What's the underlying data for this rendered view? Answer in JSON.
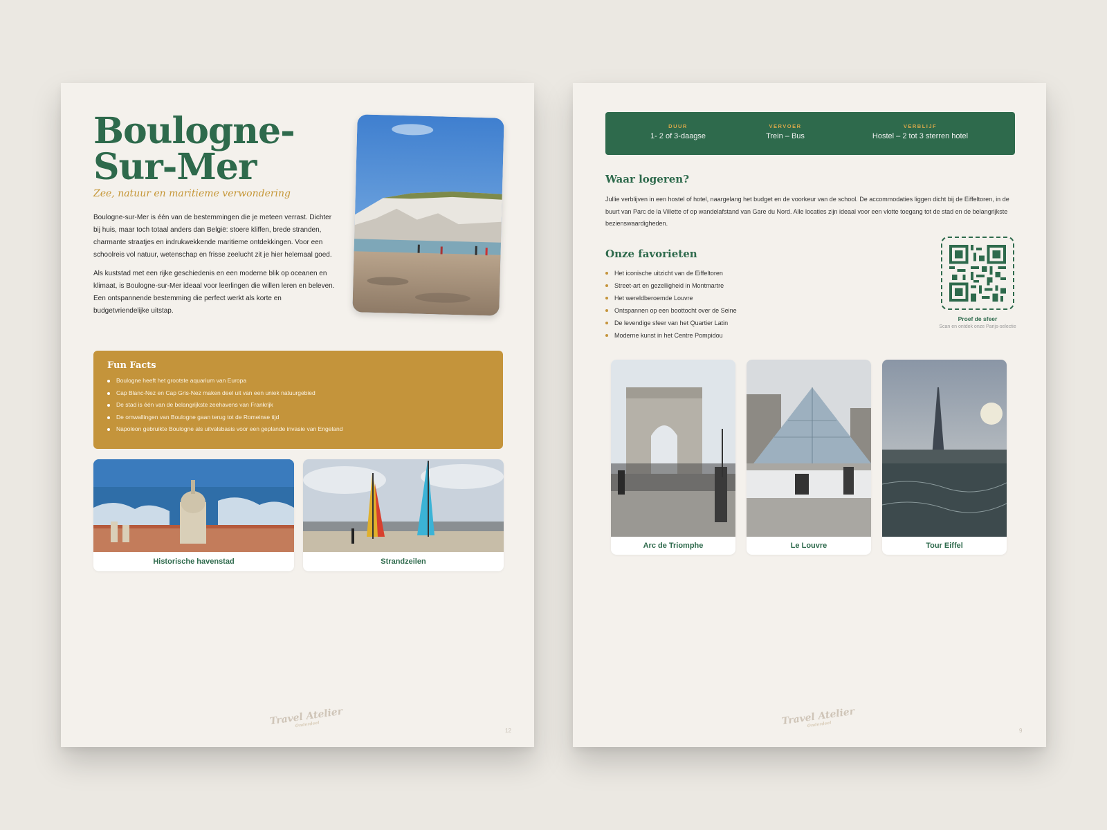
{
  "left_page": {
    "title_line1": "Boulogne-",
    "title_line2": "Sur-Mer",
    "subtitle": "Zee, natuur en maritieme verwondering",
    "paragraphs": [
      "Boulogne-sur-Mer is één van de bestemmingen die je meteen verrast. Dichter bij huis, maar toch totaal anders dan België: stoere kliffen, brede stranden, charmante straatjes en indrukwekkende maritieme ontdekkingen. Voor een schoolreis vol natuur, wetenschap en frisse zeelucht zit je hier helemaal goed.",
      "Als kuststad met een rijke geschiedenis en een moderne blik op oceanen en klimaat, is Boulogne-sur-Mer ideaal voor leerlingen die willen leren en beleven. Een ontspannende bestemming die perfect werkt als korte en budgetvriendelijke uitstap."
    ],
    "fun_facts": {
      "title": "Fun Facts",
      "items": [
        "Boulogne heeft het grootste aquarium van Europa",
        "Cap Blanc-Nez en Cap Gris-Nez maken deel uit van een uniek natuurgebied",
        "De stad is één van de belangrijkste zeehavens van Frankrijk",
        "De omwallingen van Boulogne gaan terug tot de Romeinse tijd",
        "Napoleon gebruikte Boulogne als uitvalsbasis voor een geplande invasie van Engeland"
      ]
    },
    "cards": [
      "Historische havenstad",
      "Strandzeilen"
    ],
    "page_number": "12"
  },
  "right_page": {
    "info": [
      {
        "label": "DUUR",
        "value": "1- 2 of 3-daagse"
      },
      {
        "label": "VERVOER",
        "value": "Trein – Bus"
      },
      {
        "label": "VERBLIJF",
        "value": "Hostel – 2 tot 3 sterren hotel"
      }
    ],
    "stay_heading": "Waar logeren?",
    "stay_text": "Jullie verblijven in een hostel of hotel, naargelang het budget en de voorkeur van de school. De accommodaties liggen dicht bij de Eiffeltoren, in de buurt van Parc de la Villette of op wandelafstand van Gare du Nord. Alle locaties zijn ideaal voor een vlotte toegang tot de stad en de belangrijkste bezienswaardigheden.",
    "favs_heading": "Onze favorieten",
    "favs": [
      "Het iconische uitzicht van de Eiffeltoren",
      "Street-art en gezelligheid in Montmartre",
      "Het wereldberoemde Louvre",
      "Ontspannen op een boottocht over de Seine",
      "De levendige sfeer van het Quartier Latin",
      "Moderne kunst in het Centre Pompidou"
    ],
    "qr_title": "Proef de sfeer",
    "qr_sub": "Scan en ontdek onze Parijs-selectie",
    "cards": [
      "Arc de Triomphe",
      "Le Louvre",
      "Tour Eiffel"
    ],
    "page_number": "9"
  },
  "logo_text": "Travel Atelier",
  "logo_sub": "Onderdeel",
  "colors": {
    "green": "#2e6a4c",
    "gold": "#c4943b",
    "page": "#f4f1ec",
    "background": "#ebe8e2"
  }
}
